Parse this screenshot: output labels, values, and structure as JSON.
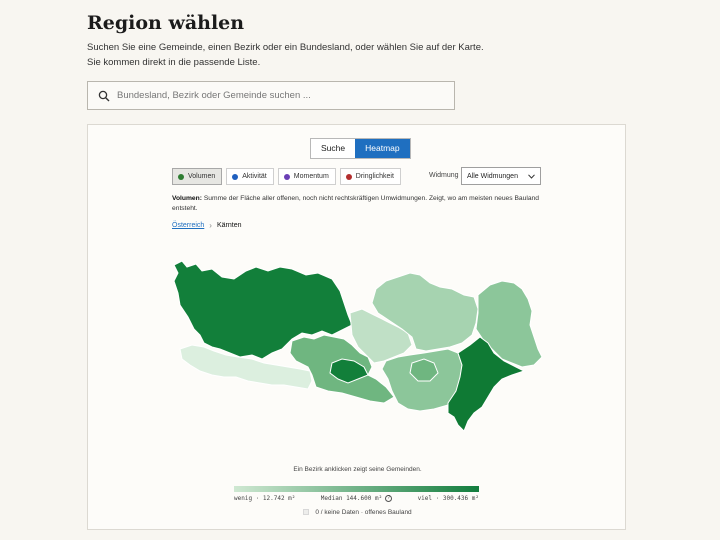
{
  "header": {
    "title": "Region wählen",
    "intro_line1": "Suchen Sie eine Gemeinde, einen Bezirk oder ein Bundesland, oder wählen Sie auf der Karte.",
    "intro_line2": "Sie kommen direkt in die passende Liste."
  },
  "search": {
    "placeholder": "Bundesland, Bezirk oder Gemeinde suchen ..."
  },
  "mode_toggle": {
    "search_label": "Suche",
    "heatmap_label": "Heatmap",
    "active": "Heatmap"
  },
  "metrics": [
    {
      "label": "Volumen",
      "color": "#2e7d32",
      "active": true
    },
    {
      "label": "Aktivität",
      "color": "#1f5fbf",
      "active": false
    },
    {
      "label": "Momentum",
      "color": "#6a3fb5",
      "active": false
    },
    {
      "label": "Dringlichkeit",
      "color": "#b32e2e",
      "active": false
    }
  ],
  "widmung": {
    "label": "Widmung",
    "selected": "Alle Widmungen"
  },
  "description": {
    "term": "Volumen:",
    "text": "Summe der Fläche aller offenen, noch nicht rechtskräftigen Umwidmungen. Zeigt, wo am meisten neues Bauland entsteht."
  },
  "breadcrumb": {
    "root": "Österreich",
    "current": "Kärnten"
  },
  "map": {
    "hint": "Ein Bezirk anklicken zeigt seine Gemeinden.",
    "colors": {
      "darkest": "#0f7a34",
      "dark": "#127f3a",
      "mid": "#6fb680",
      "mid_light": "#8cc69a",
      "light": "#a6d3b0",
      "lighter": "#c0e0c6",
      "lightest": "#dcefdf"
    }
  },
  "legend": {
    "min_label": "wenig · 12.742 m²",
    "median_label": "Median 144.600 m²",
    "max_label": "viel · 300.436 m²",
    "nodata_label": "0 / keine Daten · offenes Bauland"
  }
}
